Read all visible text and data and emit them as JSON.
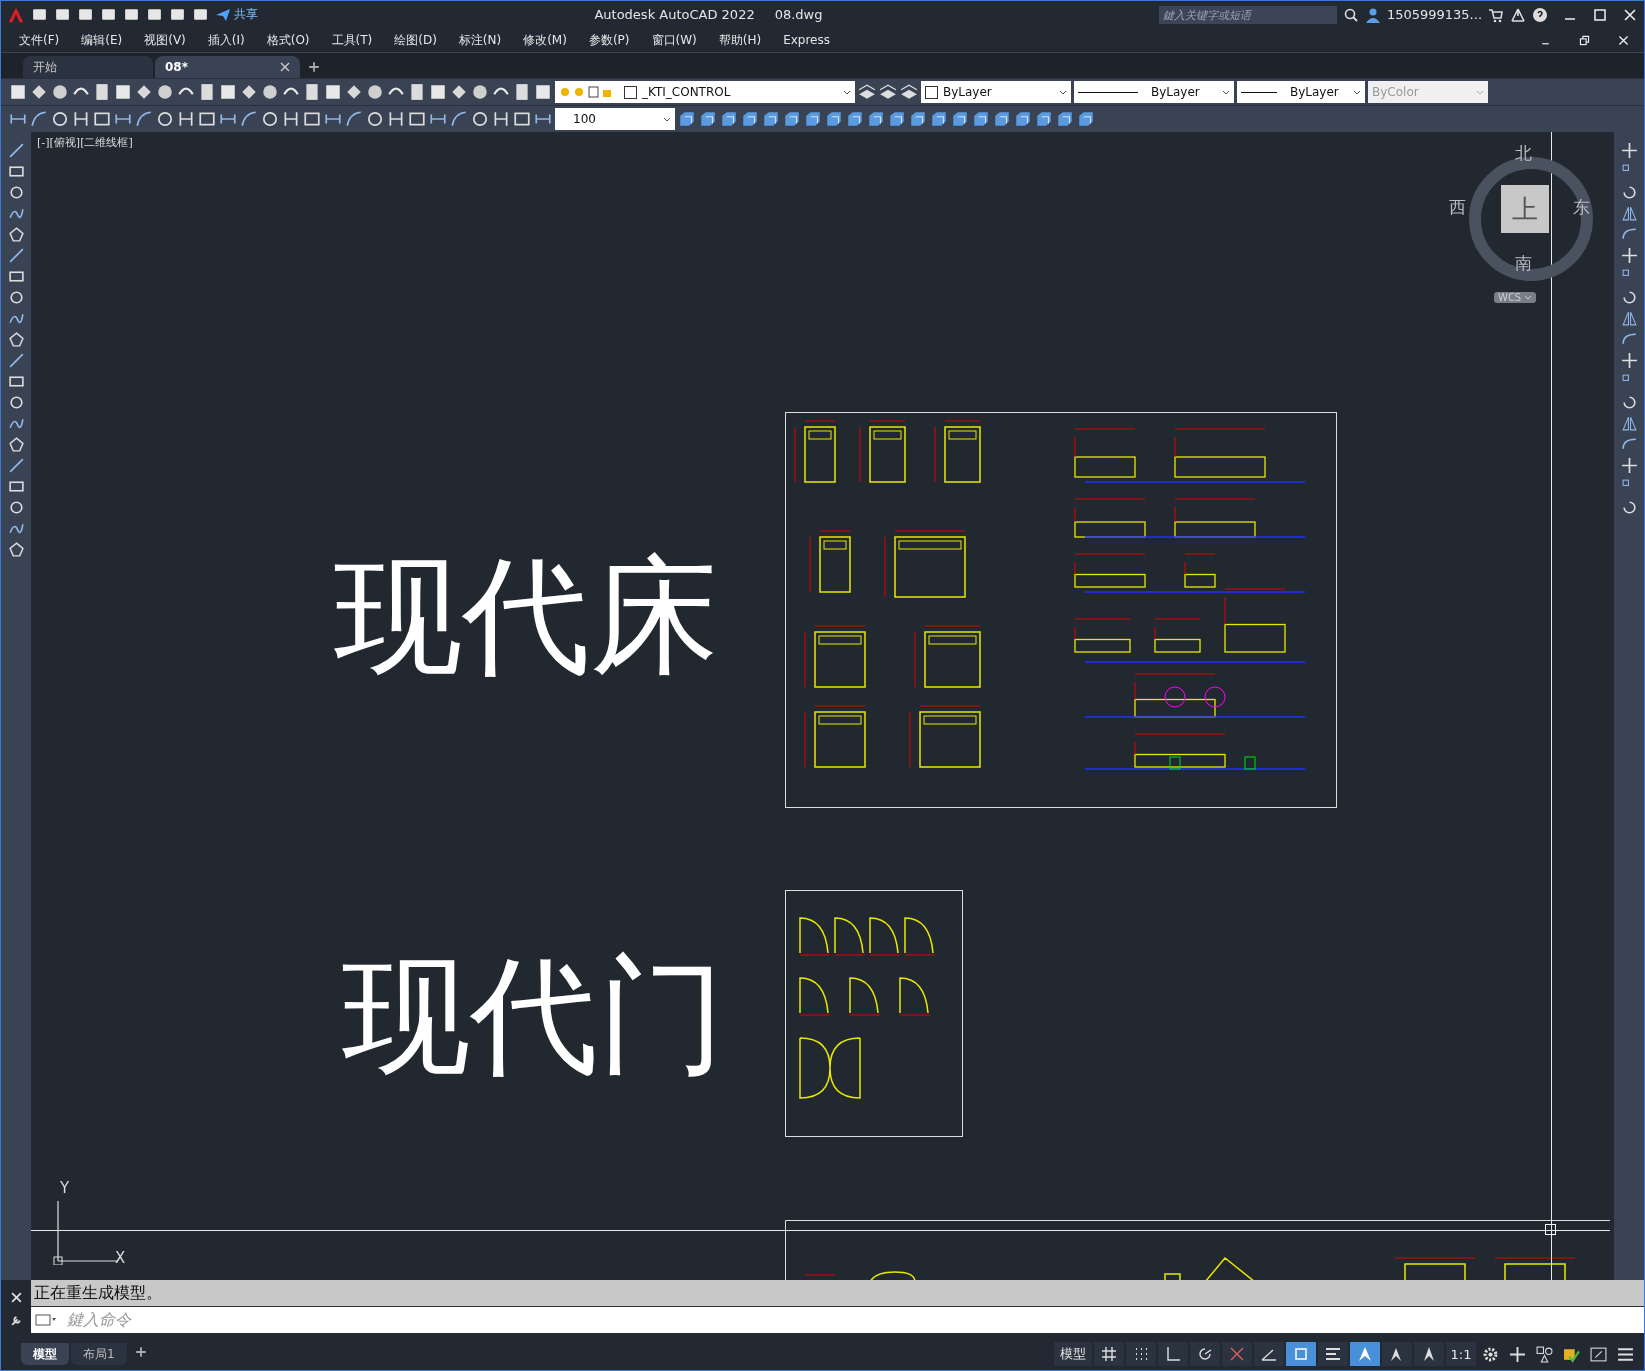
{
  "title_bar": {
    "share": "共享",
    "app_title": "Autodesk AutoCAD 2022",
    "file_name": "08.dwg",
    "search": {
      "placeholder": "鍵入关键字或短语"
    },
    "user": "1505999135..."
  },
  "menu": [
    "文件(F)",
    "编辑(E)",
    "视图(V)",
    "插入(I)",
    "格式(O)",
    "工具(T)",
    "绘图(D)",
    "标注(N)",
    "修改(M)",
    "参数(P)",
    "窗口(W)",
    "帮助(H)",
    "Express"
  ],
  "doc_tabs": [
    {
      "label": "开始",
      "selected": false
    },
    {
      "label": "08*",
      "selected": true
    }
  ],
  "properties": {
    "layer": "_KTI_CONTROL",
    "color_control": "ByLayer",
    "linetype": "ByLayer",
    "lineweight": "ByLayer",
    "plot_style": {
      "value": "ByColor",
      "disabled": true
    }
  },
  "scale_field": "100",
  "viewport": {
    "label": "[-][俯视][二维线框]",
    "bed_title": "现代床",
    "door_title": "现代门"
  },
  "viewcube": {
    "north": "北",
    "south": "南",
    "east": "东",
    "west": "西",
    "face": "上",
    "wcs": "WCS"
  },
  "ucs": {
    "x": "X",
    "y": "Y"
  },
  "command": {
    "history": "正在重生成模型。",
    "placeholder": "鍵入命令"
  },
  "layout_tabs": [
    {
      "label": "模型",
      "selected": true
    },
    {
      "label": "布局1",
      "selected": false
    }
  ],
  "status_bar": {
    "model": "模型",
    "scale": "1:1",
    "toggles": [
      {
        "kind": "grid",
        "on": false
      },
      {
        "kind": "snap",
        "on": false
      },
      {
        "kind": "ortho",
        "on": false
      },
      {
        "kind": "polar",
        "on": false
      },
      {
        "kind": "isodraft",
        "on": false
      },
      {
        "kind": "track",
        "on": false
      },
      {
        "kind": "osnap",
        "on": true
      },
      {
        "kind": "lineweight",
        "on": false
      },
      {
        "kind": "annovis",
        "on": true
      },
      {
        "kind": "autoscale",
        "on": false
      },
      {
        "kind": "annoscale",
        "on": false
      }
    ]
  }
}
